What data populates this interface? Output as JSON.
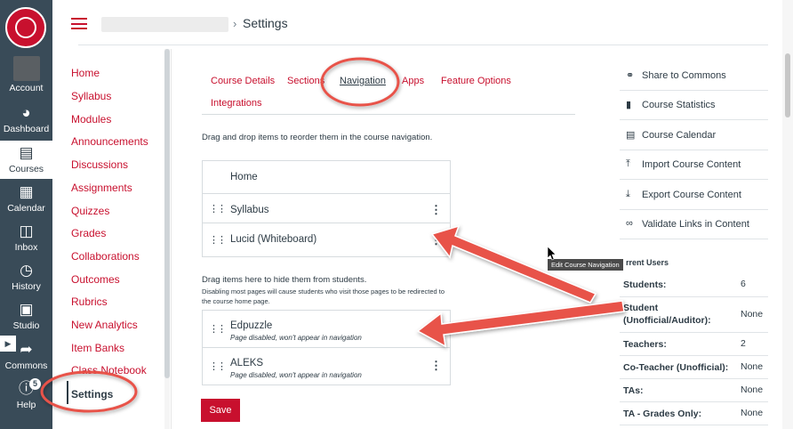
{
  "global_nav": {
    "account": "Account",
    "dashboard": "Dashboard",
    "courses": "Courses",
    "calendar": "Calendar",
    "inbox": "Inbox",
    "history": "History",
    "studio": "Studio",
    "commons": "Commons",
    "help": "Help",
    "help_badge": "5"
  },
  "header": {
    "current": "Settings"
  },
  "course_nav": [
    "Home",
    "Syllabus",
    "Modules",
    "Announcements",
    "Discussions",
    "Assignments",
    "Quizzes",
    "Grades",
    "Collaborations",
    "Outcomes",
    "Rubrics",
    "New Analytics",
    "Item Banks",
    "Class Notebook",
    "Settings"
  ],
  "tabs": [
    "Course Details",
    "Sections",
    "Navigation",
    "Apps",
    "Feature Options",
    "Integrations"
  ],
  "instructions": "Drag and drop items to reorder them in the course navigation.",
  "enabled_items": [
    "Home",
    "Syllabus",
    "Lucid (Whiteboard)"
  ],
  "hidden_section": {
    "title": "Drag items here to hide them from students.",
    "note": "Disabling most pages will cause students who visit those pages to be redirected to the course home page.",
    "items": [
      {
        "label": "Edpuzzle",
        "sub": "Page disabled, won't appear in navigation"
      },
      {
        "label": "ALEKS",
        "sub": "Page disabled, won't appear in navigation"
      }
    ]
  },
  "save_label": "Save",
  "sidebar_actions": [
    "Share to Commons",
    "Course Statistics",
    "Course Calendar",
    "Import Course Content",
    "Export Course Content",
    "Validate Links in Content"
  ],
  "tooltip": "Edit Course Navigation",
  "current_users": {
    "title": "rrent Users",
    "rows": [
      {
        "label": "Students:",
        "value": "6"
      },
      {
        "label": "Student (Unofficial/Auditor):",
        "value": "None"
      },
      {
        "label": "Teachers:",
        "value": "2"
      },
      {
        "label": "Co-Teacher (Unofficial):",
        "value": "None"
      },
      {
        "label": "TAs:",
        "value": "None"
      },
      {
        "label": "TA - Grades Only:",
        "value": "None"
      }
    ]
  },
  "colors": {
    "brand": "#c8102e",
    "nav_bg": "#394b58",
    "annotation": "#e8524a"
  }
}
